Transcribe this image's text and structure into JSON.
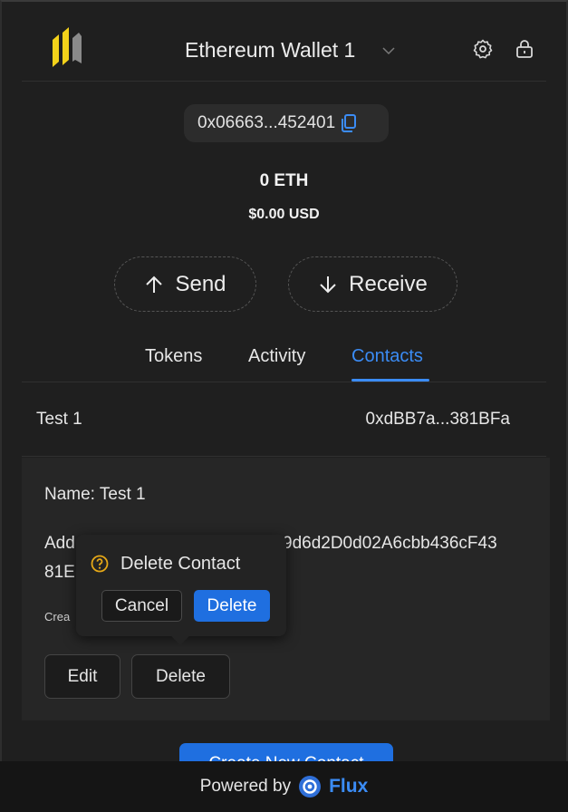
{
  "header": {
    "wallet_name": "Ethereum Wallet 1",
    "icons": [
      "wallet-logo-icon",
      "chevron-down-icon",
      "gear-icon",
      "lock-icon"
    ]
  },
  "address_pill": {
    "text": "0x06663...452401",
    "icon": "copy-icon"
  },
  "balance": {
    "eth": "0 ETH",
    "usd": "$0.00 USD"
  },
  "actions": {
    "send": "Send",
    "receive": "Receive"
  },
  "tabs": [
    {
      "label": "Tokens",
      "active": false
    },
    {
      "label": "Activity",
      "active": false
    },
    {
      "label": "Contacts",
      "active": true
    }
  ],
  "contact_row": {
    "name": "Test 1",
    "address": "0xdBB7a...381BFa"
  },
  "contact_detail": {
    "name_line": "Name: Test 1",
    "address_label": "Add",
    "address_part1": "9d6d2D0d02A6cbb436cF43",
    "address_part2": "81E",
    "created_label": "Crea",
    "edit": "Edit",
    "delete": "Delete"
  },
  "popover": {
    "title": "Delete Contact",
    "cancel": "Cancel",
    "confirm": "Delete",
    "icon": "question-circle-icon"
  },
  "create_button": "Create New Contact",
  "footer": {
    "powered_by": "Powered by",
    "brand": "Flux"
  },
  "colors": {
    "accent": "#3b8cf5",
    "button_blue": "#1f6fe0",
    "warning": "#e6a817",
    "background": "#1f1f1f"
  }
}
